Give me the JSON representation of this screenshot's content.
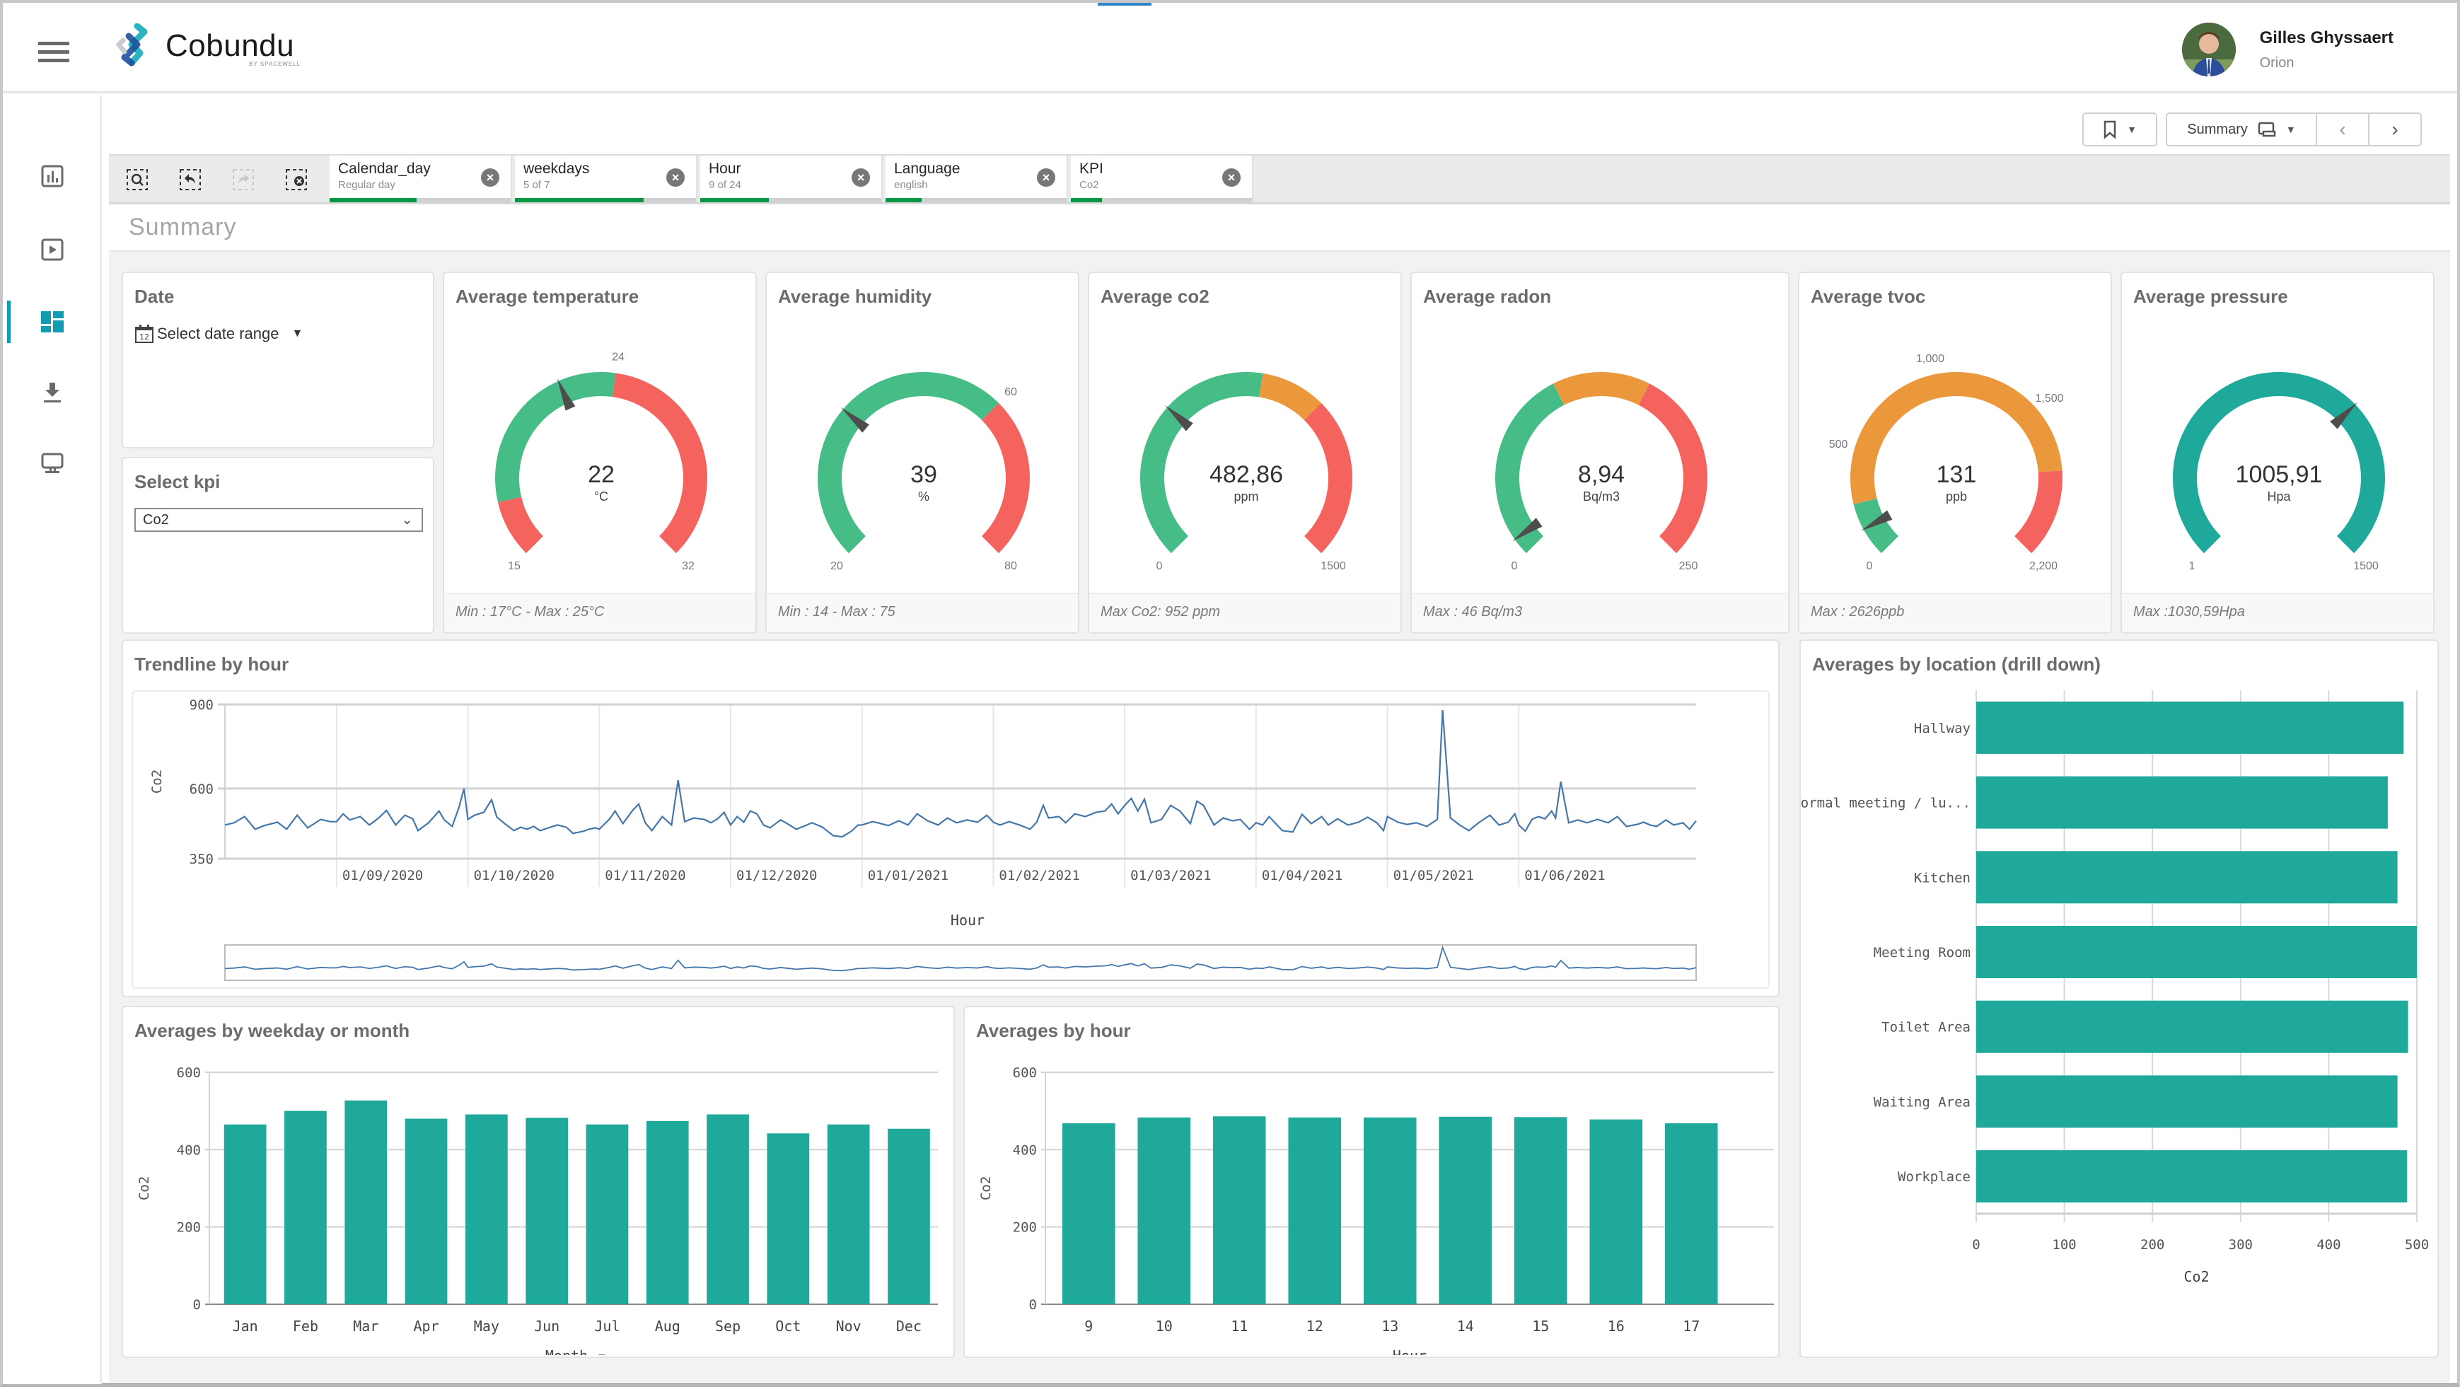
{
  "app": {
    "brand": "Cobundu",
    "brand_sub": "BY SPACEWELL",
    "user_name": "Gilles Ghyssaert",
    "user_org": "Orion"
  },
  "colors": {
    "accent": "#109db1",
    "teal": "#1ea99b",
    "green": "#46bc87",
    "orange": "#eb983d",
    "red": "#f5635f",
    "line": "#4477aa",
    "selection_green": "#009845"
  },
  "sidebar": {
    "items": [
      {
        "icon": "bar-chart-icon",
        "active": false
      },
      {
        "icon": "play-icon",
        "active": false
      },
      {
        "icon": "dashboard-icon",
        "active": true
      },
      {
        "icon": "download-icon",
        "active": false
      },
      {
        "icon": "monitor-icon",
        "active": false
      }
    ]
  },
  "toolbar": {
    "sheet_label": "Summary"
  },
  "filters": [
    {
      "name": "Calendar_day",
      "value": "Regular day",
      "fraction": 0.48
    },
    {
      "name": "weekdays",
      "value": "5 of 7",
      "fraction": 0.71
    },
    {
      "name": "Hour",
      "value": "9 of 24",
      "fraction": 0.38
    },
    {
      "name": "Language",
      "value": "english",
      "fraction": 0.2
    },
    {
      "name": "KPI",
      "value": "Co2",
      "fraction": 0.17
    }
  ],
  "sheet_title": "Summary",
  "date_filter": {
    "title": "Date",
    "placeholder": "Select date range"
  },
  "kpi_filter": {
    "title": "Select kpi",
    "selected": "Co2"
  },
  "gauges": [
    {
      "title": "Average temperature",
      "value": 22,
      "display": "22",
      "unit": "°C",
      "min": 15,
      "max": 32,
      "bands": [
        {
          "to": 17,
          "color": "red"
        },
        {
          "to": 24,
          "color": "green"
        },
        {
          "to": 32,
          "color": "red"
        }
      ],
      "ticks": [
        15,
        24,
        32
      ],
      "footer": "Min : 17°C - Max : 25°C"
    },
    {
      "title": "Average humidity",
      "value": 39,
      "display": "39",
      "unit": "%",
      "min": 20,
      "max": 80,
      "bands": [
        {
          "to": 60,
          "color": "green"
        },
        {
          "to": 80,
          "color": "red"
        }
      ],
      "ticks": [
        20,
        60,
        80
      ],
      "footer": "Min : 14 - Max : 75"
    },
    {
      "title": "Average co2",
      "value": 482.86,
      "display": "482,86",
      "unit": "ppm",
      "min": 0,
      "max": 1500,
      "bands": [
        {
          "to": 800,
          "color": "green"
        },
        {
          "to": 1000,
          "color": "orange"
        },
        {
          "to": 1500,
          "color": "red"
        }
      ],
      "ticks": [
        0,
        1500
      ],
      "footer": "Max Co2: 952 ppm"
    },
    {
      "title": "Average radon",
      "value": 8.94,
      "display": "8,94",
      "unit": "Bq/m3",
      "min": 0,
      "max": 250,
      "bands": [
        {
          "to": 100,
          "color": "green"
        },
        {
          "to": 150,
          "color": "orange"
        },
        {
          "to": 250,
          "color": "red"
        }
      ],
      "ticks": [
        0,
        250
      ],
      "footer": "Max : 46 Bq/m3"
    },
    {
      "title": "Average tvoc",
      "value": 131,
      "display": "131",
      "unit": "ppb",
      "min": 0,
      "max": 2200,
      "bands": [
        {
          "to": 250,
          "color": "green"
        },
        {
          "to": 1800,
          "color": "orange"
        },
        {
          "to": 2200,
          "color": "red"
        }
      ],
      "ticks": [
        0,
        500,
        1000,
        1500,
        2200
      ],
      "tick_labels": [
        "0",
        "500",
        "1,000",
        "1,500",
        "2,200"
      ],
      "footer": "Max : 2626ppb"
    },
    {
      "title": "Average pressure",
      "value": 1005.91,
      "display": "1005,91",
      "unit": "Hpa",
      "min": 1,
      "max": 1500,
      "bands": [
        {
          "to": 1500,
          "color": "teal"
        }
      ],
      "ticks": [
        1,
        1500
      ],
      "footer": "Max :1030,59Hpa"
    }
  ],
  "chart_data": [
    {
      "id": "trendline",
      "type": "line",
      "title": "Trendline by hour",
      "xlabel": "Hour",
      "ylabel": "Co2",
      "ylim": [
        350,
        900
      ],
      "yticks": [
        350,
        600,
        900
      ],
      "xticks": [
        "01/09/2020",
        "01/10/2020",
        "01/11/2020",
        "01/12/2020",
        "01/01/2021",
        "01/02/2021",
        "01/03/2021",
        "01/04/2021",
        "01/05/2021",
        "01/06/2021"
      ],
      "x_range_months": [
        -0.85,
        10.35
      ],
      "series": [
        {
          "name": "Co2",
          "points": [
            [
              -0.85,
              470
            ],
            [
              -0.78,
              478
            ],
            [
              -0.7,
              500
            ],
            [
              -0.62,
              455
            ],
            [
              -0.55,
              468
            ],
            [
              -0.45,
              480
            ],
            [
              -0.38,
              455
            ],
            [
              -0.3,
              505
            ],
            [
              -0.22,
              460
            ],
            [
              -0.12,
              490
            ],
            [
              -0.05,
              482
            ],
            [
              0.0,
              482
            ],
            [
              0.05,
              510
            ],
            [
              0.1,
              488
            ],
            [
              0.18,
              500
            ],
            [
              0.25,
              470
            ],
            [
              0.32,
              495
            ],
            [
              0.38,
              522
            ],
            [
              0.45,
              470
            ],
            [
              0.52,
              505
            ],
            [
              0.58,
              492
            ],
            [
              0.62,
              450
            ],
            [
              0.7,
              478
            ],
            [
              0.78,
              520
            ],
            [
              0.82,
              488
            ],
            [
              0.88,
              465
            ],
            [
              0.93,
              530
            ],
            [
              0.97,
              600
            ],
            [
              1.0,
              490
            ],
            [
              1.05,
              505
            ],
            [
              1.12,
              515
            ],
            [
              1.18,
              560
            ],
            [
              1.22,
              498
            ],
            [
              1.28,
              475
            ],
            [
              1.35,
              450
            ],
            [
              1.4,
              462
            ],
            [
              1.45,
              455
            ],
            [
              1.5,
              465
            ],
            [
              1.55,
              450
            ],
            [
              1.6,
              458
            ],
            [
              1.68,
              470
            ],
            [
              1.75,
              462
            ],
            [
              1.8,
              440
            ],
            [
              1.88,
              448
            ],
            [
              1.92,
              455
            ],
            [
              1.97,
              460
            ],
            [
              2.0,
              455
            ],
            [
              2.08,
              492
            ],
            [
              2.12,
              520
            ],
            [
              2.18,
              475
            ],
            [
              2.25,
              520
            ],
            [
              2.3,
              545
            ],
            [
              2.35,
              478
            ],
            [
              2.4,
              450
            ],
            [
              2.48,
              500
            ],
            [
              2.55,
              470
            ],
            [
              2.6,
              630
            ],
            [
              2.65,
              482
            ],
            [
              2.72,
              495
            ],
            [
              2.8,
              490
            ],
            [
              2.85,
              478
            ],
            [
              2.9,
              492
            ],
            [
              2.95,
              515
            ],
            [
              3.0,
              470
            ],
            [
              3.05,
              500
            ],
            [
              3.1,
              480
            ],
            [
              3.15,
              520
            ],
            [
              3.2,
              510
            ],
            [
              3.25,
              470
            ],
            [
              3.3,
              460
            ],
            [
              3.38,
              488
            ],
            [
              3.42,
              478
            ],
            [
              3.5,
              455
            ],
            [
              3.58,
              470
            ],
            [
              3.62,
              478
            ],
            [
              3.7,
              462
            ],
            [
              3.78,
              432
            ],
            [
              3.85,
              428
            ],
            [
              3.92,
              448
            ],
            [
              3.97,
              470
            ],
            [
              4.0,
              470
            ],
            [
              4.08,
              482
            ],
            [
              4.12,
              478
            ],
            [
              4.2,
              468
            ],
            [
              4.28,
              485
            ],
            [
              4.35,
              470
            ],
            [
              4.42,
              510
            ],
            [
              4.5,
              485
            ],
            [
              4.58,
              470
            ],
            [
              4.65,
              495
            ],
            [
              4.72,
              478
            ],
            [
              4.8,
              488
            ],
            [
              4.88,
              480
            ],
            [
              4.95,
              505
            ],
            [
              5.0,
              480
            ],
            [
              5.05,
              470
            ],
            [
              5.12,
              482
            ],
            [
              5.2,
              470
            ],
            [
              5.28,
              455
            ],
            [
              5.33,
              480
            ],
            [
              5.38,
              540
            ],
            [
              5.42,
              495
            ],
            [
              5.5,
              500
            ],
            [
              5.55,
              478
            ],
            [
              5.62,
              510
            ],
            [
              5.7,
              500
            ],
            [
              5.78,
              515
            ],
            [
              5.85,
              520
            ],
            [
              5.9,
              545
            ],
            [
              5.95,
              510
            ],
            [
              6.0,
              540
            ],
            [
              6.05,
              565
            ],
            [
              6.1,
              520
            ],
            [
              6.15,
              562
            ],
            [
              6.2,
              478
            ],
            [
              6.28,
              490
            ],
            [
              6.35,
              540
            ],
            [
              6.42,
              520
            ],
            [
              6.5,
              475
            ],
            [
              6.55,
              555
            ],
            [
              6.6,
              540
            ],
            [
              6.68,
              470
            ],
            [
              6.75,
              495
            ],
            [
              6.82,
              485
            ],
            [
              6.88,
              490
            ],
            [
              6.95,
              455
            ],
            [
              7.0,
              478
            ],
            [
              7.05,
              470
            ],
            [
              7.1,
              500
            ],
            [
              7.15,
              475
            ],
            [
              7.2,
              450
            ],
            [
              7.28,
              445
            ],
            [
              7.35,
              508
            ],
            [
              7.42,
              475
            ],
            [
              7.5,
              500
            ],
            [
              7.55,
              470
            ],
            [
              7.62,
              492
            ],
            [
              7.7,
              470
            ],
            [
              7.78,
              480
            ],
            [
              7.85,
              498
            ],
            [
              7.92,
              478
            ],
            [
              7.97,
              450
            ],
            [
              8.0,
              500
            ],
            [
              8.08,
              480
            ],
            [
              8.15,
              472
            ],
            [
              8.22,
              478
            ],
            [
              8.3,
              465
            ],
            [
              8.38,
              490
            ],
            [
              8.42,
              880
            ],
            [
              8.48,
              495
            ],
            [
              8.55,
              470
            ],
            [
              8.62,
              450
            ],
            [
              8.7,
              480
            ],
            [
              8.78,
              505
            ],
            [
              8.85,
              470
            ],
            [
              8.92,
              480
            ],
            [
              8.97,
              510
            ],
            [
              9.0,
              470
            ],
            [
              9.05,
              448
            ],
            [
              9.1,
              490
            ],
            [
              9.15,
              500
            ],
            [
              9.2,
              492
            ],
            [
              9.25,
              520
            ],
            [
              9.28,
              495
            ],
            [
              9.32,
              625
            ],
            [
              9.38,
              478
            ],
            [
              9.45,
              488
            ],
            [
              9.52,
              478
            ],
            [
              9.6,
              490
            ],
            [
              9.68,
              478
            ],
            [
              9.75,
              500
            ],
            [
              9.82,
              465
            ],
            [
              9.9,
              472
            ],
            [
              9.95,
              480
            ],
            [
              10.0,
              470
            ],
            [
              10.05,
              465
            ],
            [
              10.12,
              488
            ],
            [
              10.18,
              470
            ],
            [
              10.25,
              478
            ],
            [
              10.3,
              455
            ],
            [
              10.35,
              485
            ]
          ]
        }
      ]
    },
    {
      "id": "by_month",
      "type": "bar",
      "title": "Averages by weekday or month",
      "xlabel": "Month",
      "ylabel": "Co2",
      "ylim": [
        0,
        600
      ],
      "yticks": [
        0,
        200,
        400,
        600
      ],
      "categories": [
        "Jan",
        "Feb",
        "Mar",
        "Apr",
        "May",
        "Jun",
        "Jul",
        "Aug",
        "Sep",
        "Oct",
        "Nov",
        "Dec"
      ],
      "values": [
        465,
        500,
        527,
        480,
        491,
        482,
        465,
        474,
        491,
        442,
        465,
        454
      ]
    },
    {
      "id": "by_hour",
      "type": "bar",
      "title": "Averages by hour",
      "xlabel": "Hour",
      "ylabel": "Co2",
      "ylim": [
        0,
        600
      ],
      "yticks": [
        0,
        200,
        400,
        600
      ],
      "categories": [
        "9",
        "10",
        "11",
        "12",
        "13",
        "14",
        "15",
        "16",
        "17"
      ],
      "values": [
        468,
        483,
        486,
        483,
        483,
        485,
        484,
        478,
        468
      ]
    },
    {
      "id": "by_location",
      "type": "bar",
      "orientation": "horizontal",
      "title": "Averages by location (drill down)",
      "xlabel": "Co2",
      "ylabel": "",
      "xlim": [
        0,
        500
      ],
      "xticks": [
        0,
        100,
        200,
        300,
        400,
        500
      ],
      "categories": [
        "Hallway",
        "Informal meeting / lu...",
        "Kitchen",
        "Meeting Room",
        "Toilet Area",
        "Waiting Area",
        "Workplace"
      ],
      "values": [
        485,
        467,
        478,
        500,
        490,
        478,
        489
      ]
    }
  ]
}
